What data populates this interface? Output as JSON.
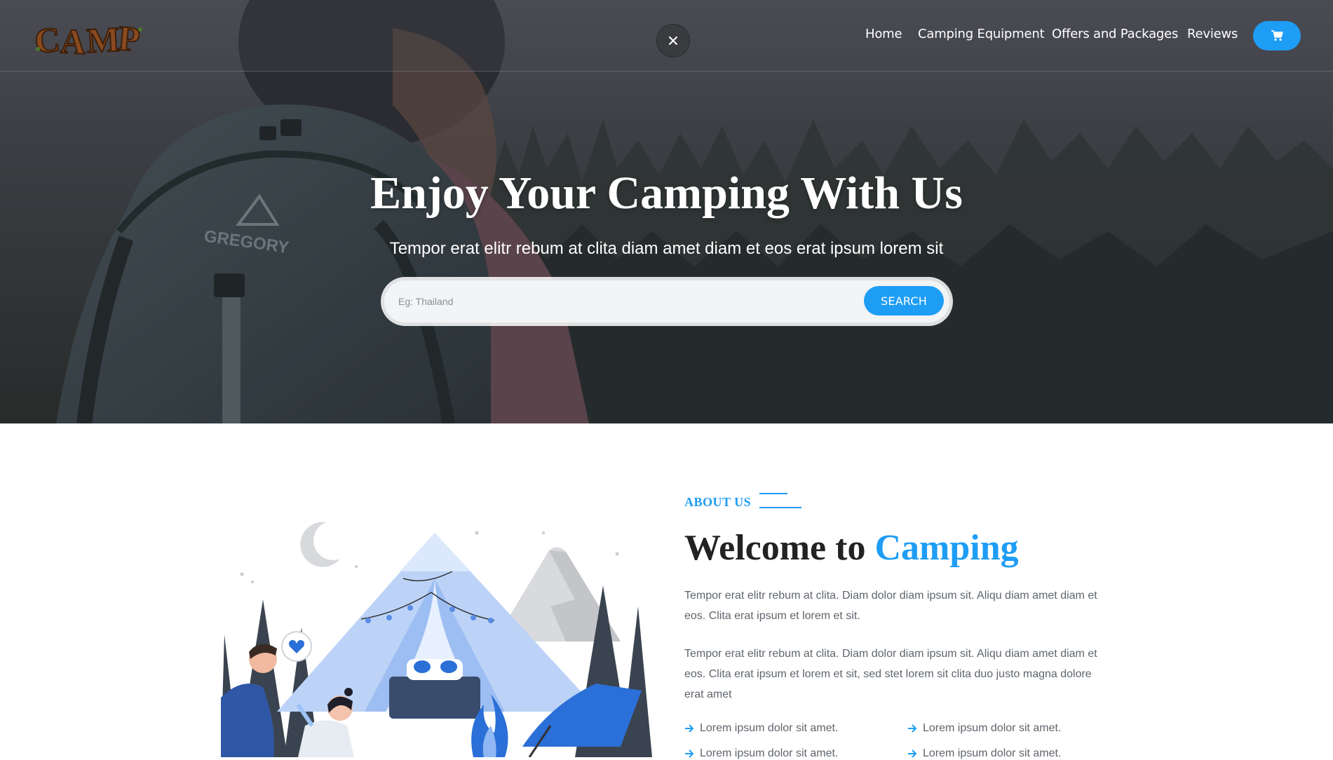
{
  "nav": {
    "logo_text": "CAMP",
    "links": [
      "Home",
      "Camping Equipment",
      "Offers and Packages",
      "Reviews"
    ],
    "cart_icon": "cart-icon",
    "close_icon": "close-icon"
  },
  "hero": {
    "title": "Enjoy Your Camping With Us",
    "subtitle": "Tempor erat elitr rebum at clita diam amet diam et eos erat ipsum lorem sit",
    "search_placeholder": "Eg: Thailand",
    "search_button": "SEARCH"
  },
  "about": {
    "label": "ABOUT US",
    "title_prefix": "Welcome to ",
    "title_accent": "Camping",
    "para1": "Tempor erat elitr rebum at clita. Diam dolor diam ipsum sit. Aliqu diam amet diam et eos. Clita erat ipsum et lorem et sit.",
    "para2": "Tempor erat elitr rebum at clita. Diam dolor diam ipsum sit. Aliqu diam amet diam et eos. Clita erat ipsum et lorem et sit, sed stet lorem sit clita duo justo magna dolore erat amet",
    "checklist": [
      "Lorem ipsum dolor sit amet.",
      "Lorem ipsum dolor sit amet.",
      "Lorem ipsum dolor sit amet.",
      "Lorem ipsum dolor sit amet."
    ]
  },
  "colors": {
    "accent": "#1e9df5",
    "heading": "#222222",
    "body_text": "#5f656d"
  }
}
